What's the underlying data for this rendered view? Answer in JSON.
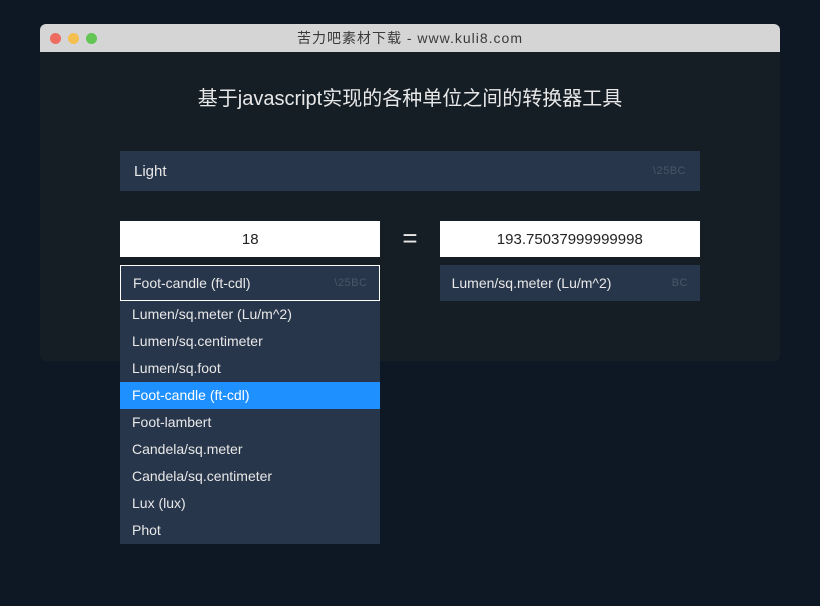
{
  "titlebar": {
    "title": "苦力吧素材下载 - www.kuli8.com"
  },
  "heading": "基于javascript实现的各种单位之间的转换器工具",
  "category": {
    "label": "Light",
    "chevron": "\\25BC"
  },
  "left": {
    "value": "18",
    "unit": "Foot-candle (ft-cdl)",
    "chevron": "\\25BC"
  },
  "equals": "=",
  "right": {
    "value": "193.75037999999998",
    "unit": "Lumen/sq.meter (Lu/m^2)",
    "chevron": "BC"
  },
  "dropdown": {
    "options": [
      "Lumen/sq.meter (Lu/m^2)",
      "Lumen/sq.centimeter",
      "Lumen/sq.foot",
      "Foot-candle (ft-cdl)",
      "Foot-lambert",
      "Candela/sq.meter",
      "Candela/sq.centimeter",
      "Lux (lux)",
      "Phot"
    ],
    "selectedIndex": 3
  }
}
